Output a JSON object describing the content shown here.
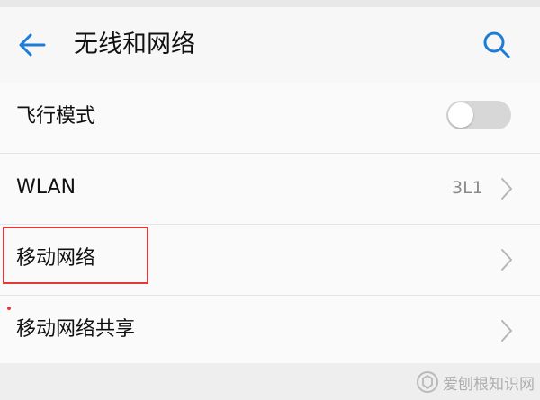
{
  "header": {
    "title": "无线和网络",
    "back_icon": "arrow-left-icon",
    "search_icon": "search-icon",
    "accent_color": "#1e7bd6"
  },
  "settings": [
    {
      "label": "飞行模式",
      "control": "toggle",
      "toggle_on": false
    },
    {
      "label": "WLAN",
      "value": "3L1",
      "control": "chevron"
    },
    {
      "label": "移动网络",
      "control": "chevron",
      "highlighted": true
    },
    {
      "label": "移动网络共享",
      "control": "chevron"
    }
  ],
  "highlight_color": "#e23a3a",
  "watermark": {
    "text": "爱刨根知识网"
  }
}
